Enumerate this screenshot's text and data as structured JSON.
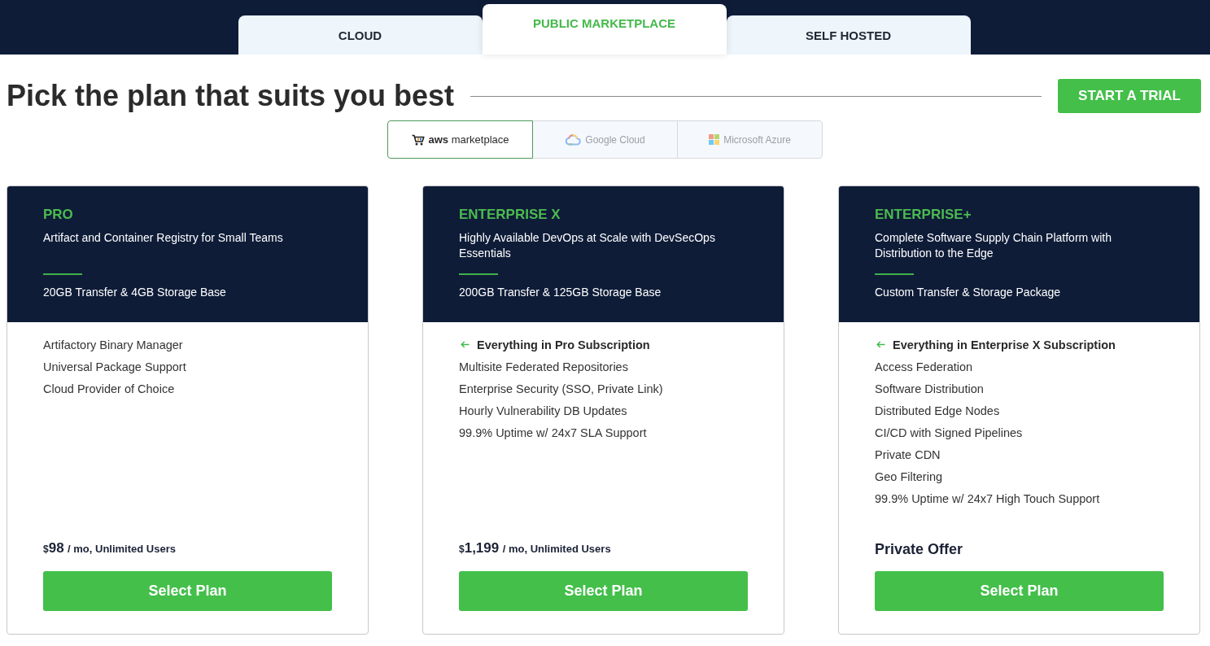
{
  "top_tabs": [
    {
      "label": "CLOUD",
      "selected": false
    },
    {
      "label": "PUBLIC MARKETPLACE",
      "selected": true
    },
    {
      "label": "SELF HOSTED",
      "selected": false
    }
  ],
  "heading": "Pick the plan that suits you best",
  "trial_button": "START A TRIAL",
  "providers": [
    {
      "kind": "aws",
      "label": "**aws** marketplace",
      "selected": true
    },
    {
      "kind": "google",
      "label": "Google Cloud",
      "selected": false
    },
    {
      "kind": "azure",
      "label": "Microsoft Azure",
      "selected": false
    }
  ],
  "plans": [
    {
      "name": "PRO",
      "tagline": "Artifact and Container Registry for Small Teams",
      "storage": "20GB Transfer & 4GB Storage Base",
      "features": [
        {
          "kind": "item",
          "text": "Artifactory Binary Manager"
        },
        {
          "kind": "item",
          "text": "Universal Package Support"
        },
        {
          "kind": "item",
          "text": "Cloud Provider of Choice"
        }
      ],
      "price": {
        "kind": "price",
        "currency": "$",
        "amount": "98",
        "period": "/ mo, Unlimited Users"
      },
      "button": "Select Plan"
    },
    {
      "name": "ENTERPRISE X",
      "tagline": "Highly Available DevOps at Scale with DevSecOps Essentials",
      "storage": "200GB Transfer & 125GB Storage Base",
      "features": [
        {
          "kind": "inherited",
          "text": "Everything in Pro Subscription"
        },
        {
          "kind": "item",
          "text": "Multisite Federated Repositories"
        },
        {
          "kind": "item",
          "text": "Enterprise Security (SSO, Private Link)"
        },
        {
          "kind": "item",
          "text": "Hourly Vulnerability DB Updates"
        },
        {
          "kind": "item",
          "text": "99.9% Uptime w/ 24x7 SLA Support"
        }
      ],
      "price": {
        "kind": "price",
        "currency": "$",
        "amount": "1,199",
        "period": "/ mo, Unlimited Users"
      },
      "button": "Select Plan"
    },
    {
      "name": "ENTERPRISE+",
      "tagline": "Complete Software Supply Chain Platform with Distribution to the Edge",
      "storage": "Custom Transfer & Storage Package",
      "features": [
        {
          "kind": "inherited",
          "text": "Everything in Enterprise X Subscription"
        },
        {
          "kind": "item",
          "text": "Access Federation"
        },
        {
          "kind": "item",
          "text": "Software Distribution"
        },
        {
          "kind": "item",
          "text": "Distributed Edge Nodes"
        },
        {
          "kind": "item",
          "text": "CI/CD with Signed Pipelines"
        },
        {
          "kind": "item",
          "text": "Private CDN"
        },
        {
          "kind": "item",
          "text": "Geo Filtering"
        },
        {
          "kind": "item",
          "text": "99.9% Uptime w/ 24x7 High Touch Support"
        }
      ],
      "price": {
        "kind": "offer",
        "text": "Private Offer"
      },
      "button": "Select Plan"
    }
  ]
}
